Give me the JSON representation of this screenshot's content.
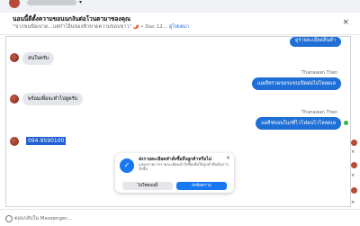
{
  "top": {
    "account_name": "",
    "caret": "▾"
  },
  "header": {
    "title": "นอนนี้ดีตั้งความขอนนกงันต่อโวนตามาของคุณ",
    "preview": "\"ขากขนขิอเขาด...แต่กำโอ็นของฟัวขาดความขอบขาว\" 🌶️ • Dac 12...",
    "preview_link": "ดูไฟเตมา",
    "close": "×"
  },
  "messages": {
    "top_out": "ดูรายละเอียดสินค้า",
    "in1": "สนใจครับ",
    "sender1": "Thanawan Then",
    "out1": "แเผลืชรวดขอรแขบเปิดต่อไปโหลดเล",
    "in2": "พร้อมเพื่อจะทำไปดูครับ",
    "sender2": "Thanawan Then",
    "out2": "แผลืชขอนในก่ที่ไวโฟมนไวโหลดเล",
    "phone": "094-9590100"
  },
  "card": {
    "icon": "✓",
    "title": "ส่งรายละเอียดคำสั่งซื้อถึงลูกค้าหรือไม่",
    "desc": "แสดงรายการรายละเอียดคำสั่งซื้อเพื่อให้ลูกค้ายืนยันการสั่งซื้อ",
    "close": "×",
    "secondary_label": "ไม่ใช่ตอนนี้",
    "primary_label": "ส่งข้อความ"
  },
  "composer": {
    "placeholder": "ตอบกลับใน Messenger..."
  },
  "right_column": {
    "x_marks": [
      "×",
      "×",
      "×"
    ]
  },
  "colors": {
    "accent": "#1877f2",
    "outgoing_bubble": "#1f6fd6",
    "incoming_bubble": "#e4e6eb",
    "online": "#2eb84b"
  }
}
